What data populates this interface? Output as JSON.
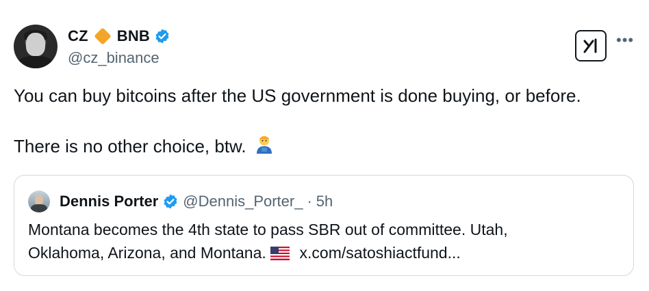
{
  "author": {
    "name": "CZ",
    "name_suffix": "BNB",
    "handle": "@cz_binance",
    "diamond_color": "#f3a52a",
    "verified_color": "#1d9bf0"
  },
  "tweet": {
    "line1": "You can buy bitcoins after the US government is done buying, or before.",
    "line2": "There is no other choice, btw."
  },
  "quoted": {
    "name": "Dennis Porter",
    "handle": "@Dennis_Porter_",
    "separator": "·",
    "time": "5h",
    "text_line1": "Montana becomes the 4th state to pass SBR out of committee. Utah,",
    "text_line2_before_flag": "Oklahoma, Arizona, and Montana.",
    "link": "x.com/satoshiactfund..."
  },
  "icons": {
    "verified": "verified-badge-icon",
    "diamond": "diamond-icon",
    "logo": "x-grok-logo-icon",
    "more": "more-dots-icon",
    "emoji": "farmer-emoji-icon",
    "flag": "us-flag-icon"
  }
}
